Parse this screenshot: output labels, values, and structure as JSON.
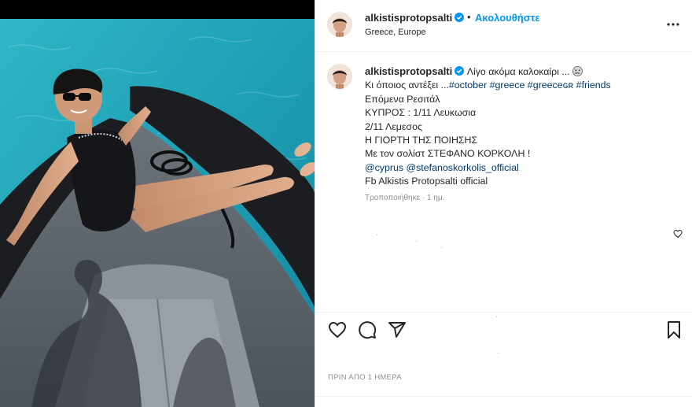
{
  "post": {
    "username": "alkistisprotopsalti",
    "follow_separator": "•",
    "follow_label": "Ακολουθήστε",
    "location": "Greece, Europe"
  },
  "caption": {
    "username": "alkistisprotopsalti",
    "line1": "Λίγο ακόμα καλοκαίρι ...",
    "line2_text": "Κι όποιος αντέξει ...",
    "hashtags": [
      "#october",
      "#greece",
      "#greeceɢʀ",
      "#friends"
    ],
    "line3": "Επόμενα Ρεσιτάλ",
    "line4": "ΚΥΠΡΟΣ : 1/11 Λευκωσια",
    "line5": "2/11 Λεμεσος",
    "line6": "Η ΓΙΟΡΤΗ ΤΗΣ ΠΟΙΗΣΗΣ",
    "line7": "Με τον σολίστ ΣΤΕΦΑΝΟ ΚΟΡΚΟΛΗ !",
    "mentions": [
      "@cyprus",
      "@stefanoskorkolis_official"
    ],
    "line9": "Fb Alkistis Protopsalti official",
    "edited": "Τροποποιήθηκε · 1 ημ."
  },
  "footer": {
    "timestamp": "ΠΡΙΝ ΑΠΟ 1 ΗΜΕΡΑ"
  },
  "icons": {
    "verified": "verified-badge-icon",
    "more": "more-options-icon",
    "like": "heart-icon",
    "comment": "comment-icon",
    "share": "send-icon",
    "save": "bookmark-icon",
    "emoji": "crying-face-emoji"
  },
  "colors": {
    "accent": "#0095f6",
    "link": "#00376b",
    "muted": "#8e8e8e",
    "text": "#262626"
  }
}
